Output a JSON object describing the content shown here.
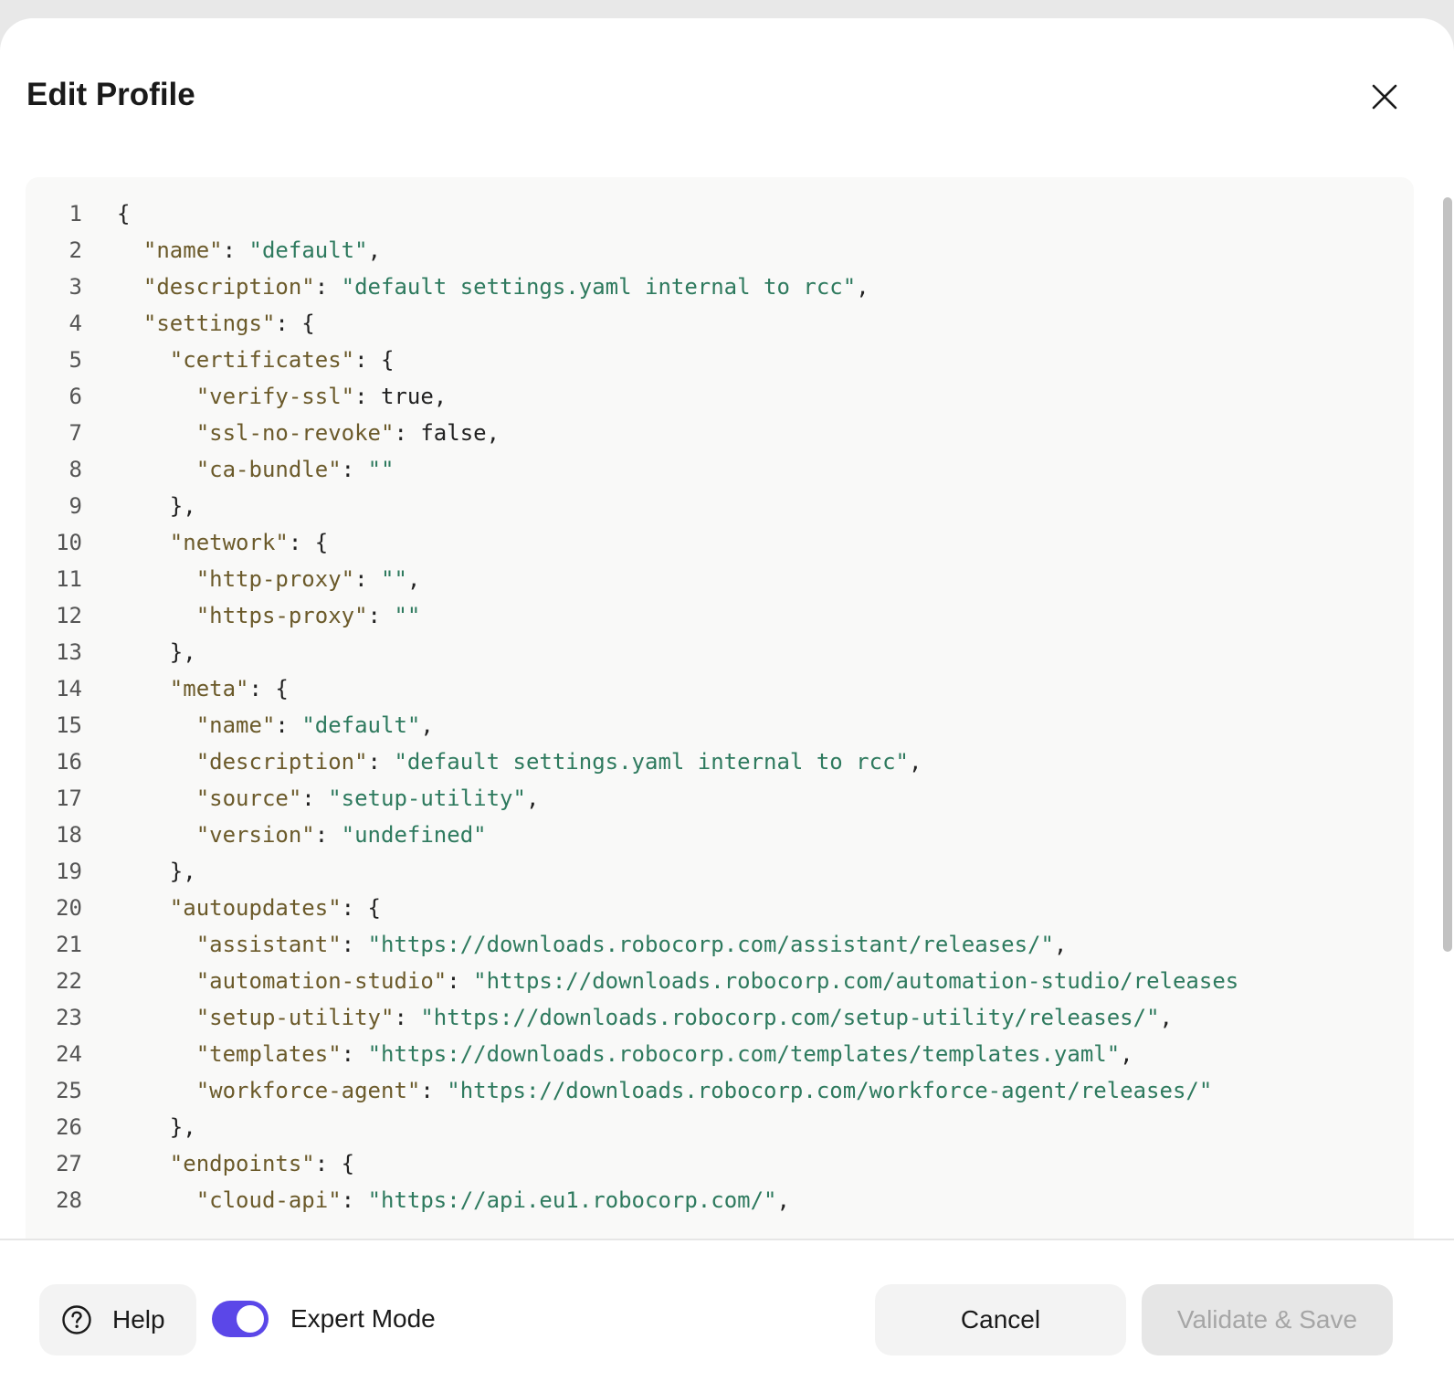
{
  "dialog": {
    "title": "Edit Profile",
    "close_icon": "close-icon"
  },
  "editor": {
    "lines": [
      {
        "num": "1",
        "text": "{"
      },
      {
        "num": "2",
        "text": "  \"name\": \"default\","
      },
      {
        "num": "3",
        "text": "  \"description\": \"default settings.yaml internal to rcc\","
      },
      {
        "num": "4",
        "text": "  \"settings\": {"
      },
      {
        "num": "5",
        "text": "    \"certificates\": {"
      },
      {
        "num": "6",
        "text": "      \"verify-ssl\": true,"
      },
      {
        "num": "7",
        "text": "      \"ssl-no-revoke\": false,"
      },
      {
        "num": "8",
        "text": "      \"ca-bundle\": \"\""
      },
      {
        "num": "9",
        "text": "    },"
      },
      {
        "num": "10",
        "text": "    \"network\": {"
      },
      {
        "num": "11",
        "text": "      \"http-proxy\": \"\","
      },
      {
        "num": "12",
        "text": "      \"https-proxy\": \"\""
      },
      {
        "num": "13",
        "text": "    },"
      },
      {
        "num": "14",
        "text": "    \"meta\": {"
      },
      {
        "num": "15",
        "text": "      \"name\": \"default\","
      },
      {
        "num": "16",
        "text": "      \"description\": \"default settings.yaml internal to rcc\","
      },
      {
        "num": "17",
        "text": "      \"source\": \"setup-utility\","
      },
      {
        "num": "18",
        "text": "      \"version\": \"undefined\""
      },
      {
        "num": "19",
        "text": "    },"
      },
      {
        "num": "20",
        "text": "    \"autoupdates\": {"
      },
      {
        "num": "21",
        "text": "      \"assistant\": \"https://downloads.robocorp.com/assistant/releases/\","
      },
      {
        "num": "22",
        "text": "      \"automation-studio\": \"https://downloads.robocorp.com/automation-studio/releases"
      },
      {
        "num": "23",
        "text": "      \"setup-utility\": \"https://downloads.robocorp.com/setup-utility/releases/\","
      },
      {
        "num": "24",
        "text": "      \"templates\": \"https://downloads.robocorp.com/templates/templates.yaml\","
      },
      {
        "num": "25",
        "text": "      \"workforce-agent\": \"https://downloads.robocorp.com/workforce-agent/releases/\""
      },
      {
        "num": "26",
        "text": "    },"
      },
      {
        "num": "27",
        "text": "    \"endpoints\": {"
      },
      {
        "num": "28",
        "text": "      \"cloud-api\": \"https://api.eu1.robocorp.com/\","
      }
    ],
    "colors": {
      "key": "#6b5a2a",
      "string": "#2e7a5e",
      "punctuation": "#222222",
      "line_number": "#555555"
    }
  },
  "footer": {
    "help_label": "Help",
    "help_icon": "question-circle-icon",
    "expert_mode_label": "Expert Mode",
    "expert_mode_on": true,
    "cancel_label": "Cancel",
    "save_label": "Validate & Save",
    "save_disabled": true,
    "accent_color": "#5b47e8"
  }
}
